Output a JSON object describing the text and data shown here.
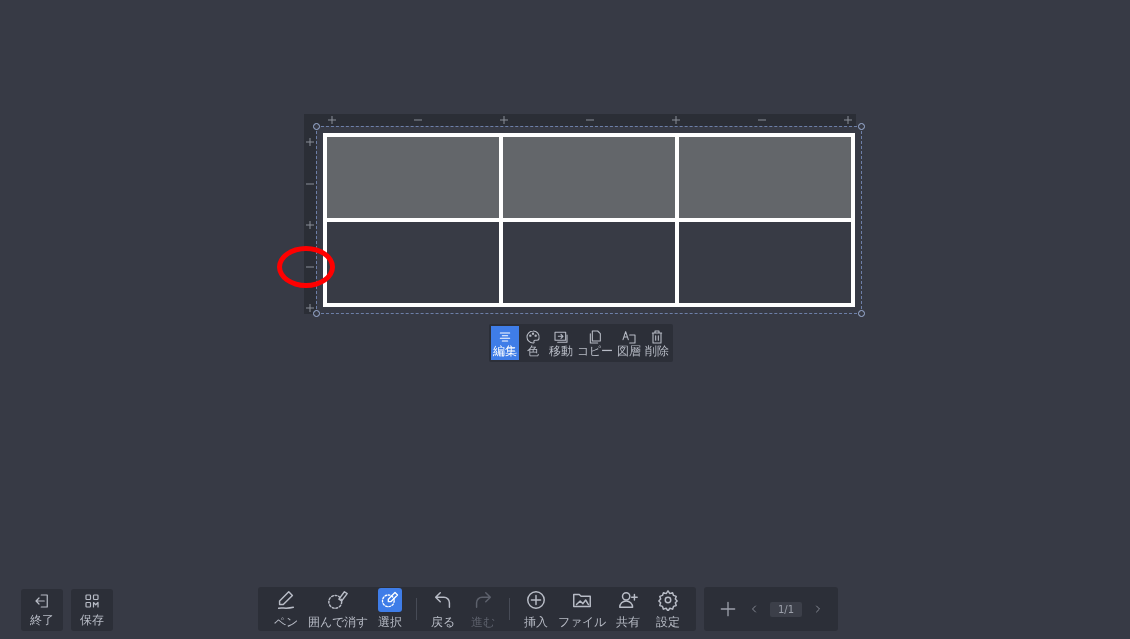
{
  "table": {
    "rows": [
      {
        "kind": "header",
        "cells": [
          "",
          "",
          ""
        ]
      },
      {
        "kind": "body",
        "cells": [
          "",
          "",
          ""
        ]
      }
    ]
  },
  "context_toolbar": [
    {
      "label": "編集",
      "selected": true
    },
    {
      "label": "色",
      "selected": false
    },
    {
      "label": "移動",
      "selected": false
    },
    {
      "label": "コピー",
      "selected": false
    },
    {
      "label": "図層",
      "selected": false
    },
    {
      "label": "削除",
      "selected": false
    }
  ],
  "left_buttons": [
    {
      "label": "終了"
    },
    {
      "label": "保存"
    }
  ],
  "main_toolbar": [
    {
      "label": "ペン",
      "selected": false,
      "disabled": false
    },
    {
      "label": "囲んで消す",
      "selected": false,
      "disabled": false
    },
    {
      "label": "選択",
      "selected": true,
      "disabled": false
    },
    {
      "label": "戻る",
      "selected": false,
      "disabled": false
    },
    {
      "label": "進む",
      "selected": false,
      "disabled": true
    },
    {
      "label": "挿入",
      "selected": false,
      "disabled": false
    },
    {
      "label": "ファイル",
      "selected": false,
      "disabled": false
    },
    {
      "label": "共有",
      "selected": false,
      "disabled": false
    },
    {
      "label": "設定",
      "selected": false,
      "disabled": false
    }
  ],
  "page_nav": {
    "page": "1/1"
  }
}
